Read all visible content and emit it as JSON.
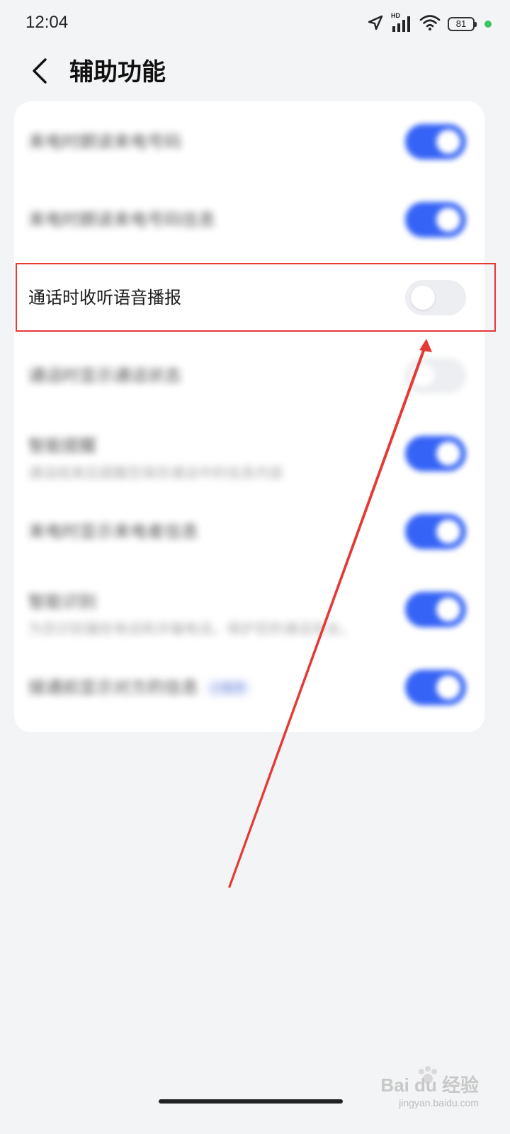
{
  "status_bar": {
    "time": "12:04",
    "battery": "81",
    "network": "HD"
  },
  "header": {
    "title": "辅助功能"
  },
  "settings": [
    {
      "label": "来电时朗读来电号码",
      "sublabel": "",
      "toggle": "on",
      "blurred": true
    },
    {
      "label": "来电时朗读来电号码信息",
      "sublabel": "",
      "toggle": "on",
      "blurred": true
    },
    {
      "label": "通话时收听语音播报",
      "sublabel": "",
      "toggle": "off",
      "blurred": false,
      "highlighted": true
    },
    {
      "label": "通话时显示通话状态",
      "sublabel": "",
      "toggle": "off",
      "blurred": true
    },
    {
      "label": "智能提醒",
      "sublabel": "通话结束后提醒您保存通话中的信息内容",
      "toggle": "on",
      "blurred": true
    },
    {
      "label": "来电时显示来电者信息",
      "sublabel": "",
      "toggle": "on",
      "blurred": true
    },
    {
      "label": "智能识别",
      "sublabel": "为您识别骚扰电话和诈骗电话，保护您的通话安全。",
      "toggle": "on",
      "blurred": true
    },
    {
      "label": "接通前显示对方的信息",
      "sublabel": "",
      "toggle": "on",
      "blurred": true,
      "badge": "小程序"
    }
  ],
  "colors": {
    "accent": "#3563f5",
    "annotation": "#e53935",
    "background": "#f3f4f6"
  },
  "watermark": {
    "brand": "Bai du 经验",
    "url": "jingyan.baidu.com"
  }
}
